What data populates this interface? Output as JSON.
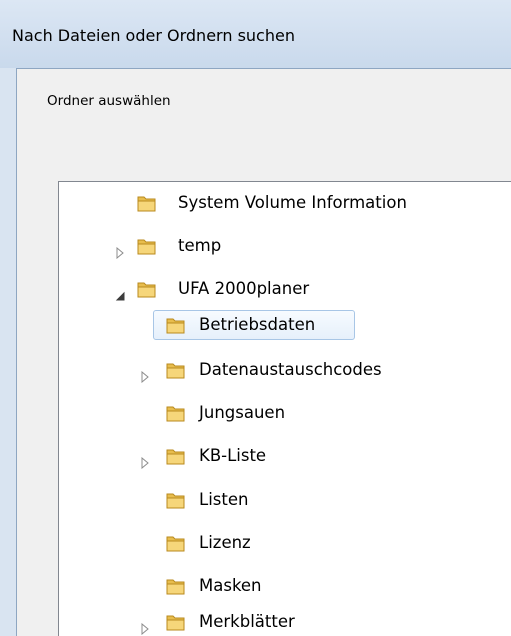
{
  "dialog": {
    "title": "Nach Dateien oder Ordnern suchen",
    "prompt": "Ordner auswählen"
  },
  "tree": {
    "items": [
      {
        "label": "System Volume Information",
        "expander": "none",
        "selected": false
      },
      {
        "label": "temp",
        "expander": "collapsed",
        "selected": false
      },
      {
        "label": "UFA 2000planer",
        "expander": "expanded",
        "selected": false
      },
      {
        "label": "Betriebsdaten",
        "expander": "none",
        "selected": true
      },
      {
        "label": "Datenaustauschcodes",
        "expander": "collapsed",
        "selected": false
      },
      {
        "label": "Jungsauen",
        "expander": "none",
        "selected": false
      },
      {
        "label": "KB-Liste",
        "expander": "collapsed",
        "selected": false
      },
      {
        "label": "Listen",
        "expander": "none",
        "selected": false
      },
      {
        "label": "Lizenz",
        "expander": "none",
        "selected": false
      },
      {
        "label": "Masken",
        "expander": "none",
        "selected": false
      },
      {
        "label": "Merkblätter",
        "expander": "collapsed",
        "selected": false
      }
    ]
  },
  "colors": {
    "selection_border": "#a8c6e6",
    "folder": "#e8bd4d"
  },
  "icons": {
    "folder": "folder-icon",
    "expander_collapsed": "triangle-right-icon",
    "expander_expanded": "triangle-down-icon"
  }
}
